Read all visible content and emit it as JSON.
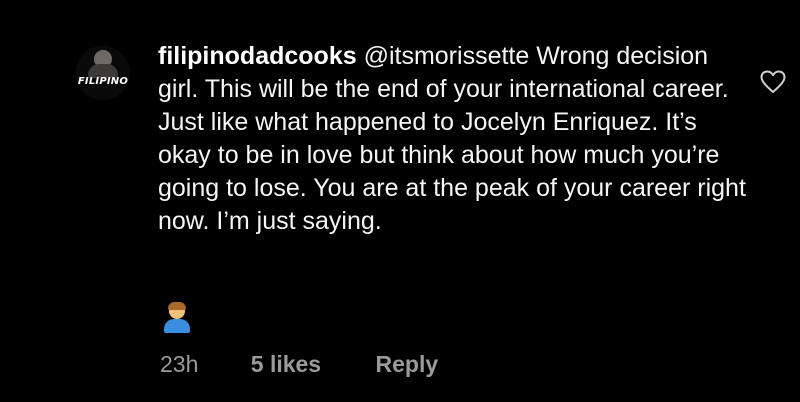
{
  "comment": {
    "avatar_text": "FILIPINO",
    "username": "filipinodadcooks",
    "mention": "@itsmorissette",
    "text": "Wrong decision girl.  This will be the end of your international career.  Just like what happened to Jocelyn Enriquez.  It’s okay to be in love but think about how much you’re going to lose.  You are at the peak of your career right now.  I’m just saying.",
    "emoji": "person-frowning-emoji",
    "time": "23h",
    "likes": "5 likes",
    "reply_label": "Reply",
    "like_icon": "heart-outline-icon"
  },
  "colors": {
    "background": "#000000",
    "text": "#f5f5f5",
    "meta": "#9a9a9a"
  }
}
